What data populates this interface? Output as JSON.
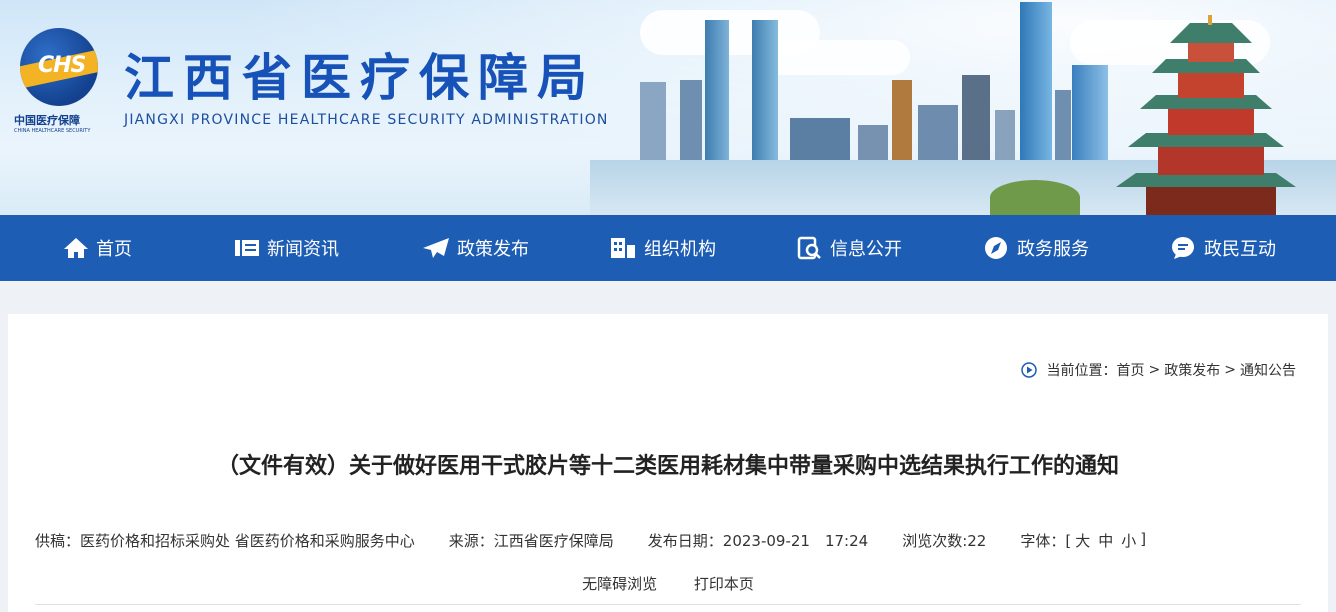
{
  "header": {
    "site_title": "江西省医疗保障局",
    "site_title_en": "JIANGXI PROVINCE HEALTHCARE SECURITY ADMINISTRATION",
    "logo_text": "CHS",
    "logo_cn": "中国医疗保障",
    "logo_en": "CHINA HEALTHCARE SECURITY"
  },
  "nav": {
    "items": [
      {
        "label": "首页",
        "icon": "home-icon"
      },
      {
        "label": "新闻资讯",
        "icon": "news-icon"
      },
      {
        "label": "政策发布",
        "icon": "paper-plane-icon"
      },
      {
        "label": "组织机构",
        "icon": "building-icon"
      },
      {
        "label": "信息公开",
        "icon": "search-doc-icon"
      },
      {
        "label": "政务服务",
        "icon": "compass-icon"
      },
      {
        "label": "政民互动",
        "icon": "chat-icon"
      }
    ]
  },
  "breadcrumb": {
    "prefix": "当前位置：",
    "items": [
      "首页",
      "政策发布",
      "通知公告"
    ],
    "separator": ">"
  },
  "article": {
    "title": "（文件有效）关于做好医用干式胶片等十二类医用耗材集中带量采购中选结果执行工作的通知",
    "contributor": "供稿：医药价格和招标采购处 省医药价格和采购服务中心",
    "source": "来源：江西省医疗保障局",
    "date": "发布日期：2023-09-21　17:24",
    "views": "浏览次数:22",
    "font_label": "字体：[",
    "font_large": "大",
    "font_medium": "中",
    "font_small": "小",
    "font_close": "]",
    "accessible": "无障碍浏览",
    "print": "打印本页"
  },
  "colors": {
    "nav_bg": "#1e5db4",
    "title_blue": "#1652b8"
  }
}
